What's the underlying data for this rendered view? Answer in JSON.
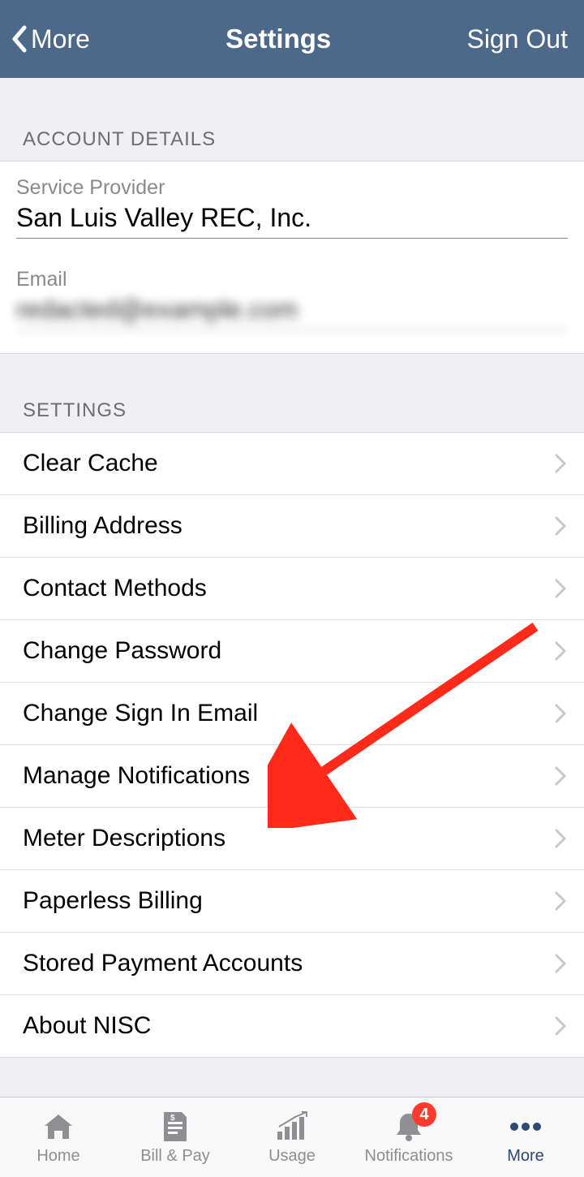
{
  "header": {
    "back_label": "More",
    "title": "Settings",
    "sign_out": "Sign Out"
  },
  "sections": {
    "account_header": "ACCOUNT DETAILS",
    "settings_header": "SETTINGS",
    "provider_label": "Service Provider",
    "provider_value": "San Luis Valley REC, Inc.",
    "email_label": "Email",
    "email_value": "redacted@example.com"
  },
  "settings_items": [
    "Clear Cache",
    "Billing Address",
    "Contact Methods",
    "Change Password",
    "Change Sign In Email",
    "Manage Notifications",
    "Meter Descriptions",
    "Paperless Billing",
    "Stored Payment Accounts",
    "About NISC"
  ],
  "tabs": {
    "home": "Home",
    "bill": "Bill & Pay",
    "usage": "Usage",
    "notifications": "Notifications",
    "notifications_badge": "4",
    "more": "More"
  },
  "colors": {
    "header_bg": "#4c698a",
    "accent": "#2b4b72",
    "arrow": "#ff2a1a"
  }
}
